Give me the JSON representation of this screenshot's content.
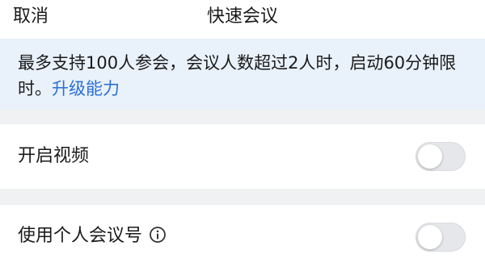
{
  "header": {
    "cancel_label": "取消",
    "title": "快速会议"
  },
  "notice": {
    "text": "最多支持100人参会，会议人数超过2人时，启动60分钟限时。",
    "upgrade_link": "升级能力",
    "background": "#e9f1fb",
    "link_color": "#2b6fd6"
  },
  "settings": {
    "enable_video": {
      "label": "开启视频",
      "enabled": false
    },
    "personal_meeting_id": {
      "label": "使用个人会议号",
      "enabled": false,
      "info_icon": "info-icon"
    }
  }
}
